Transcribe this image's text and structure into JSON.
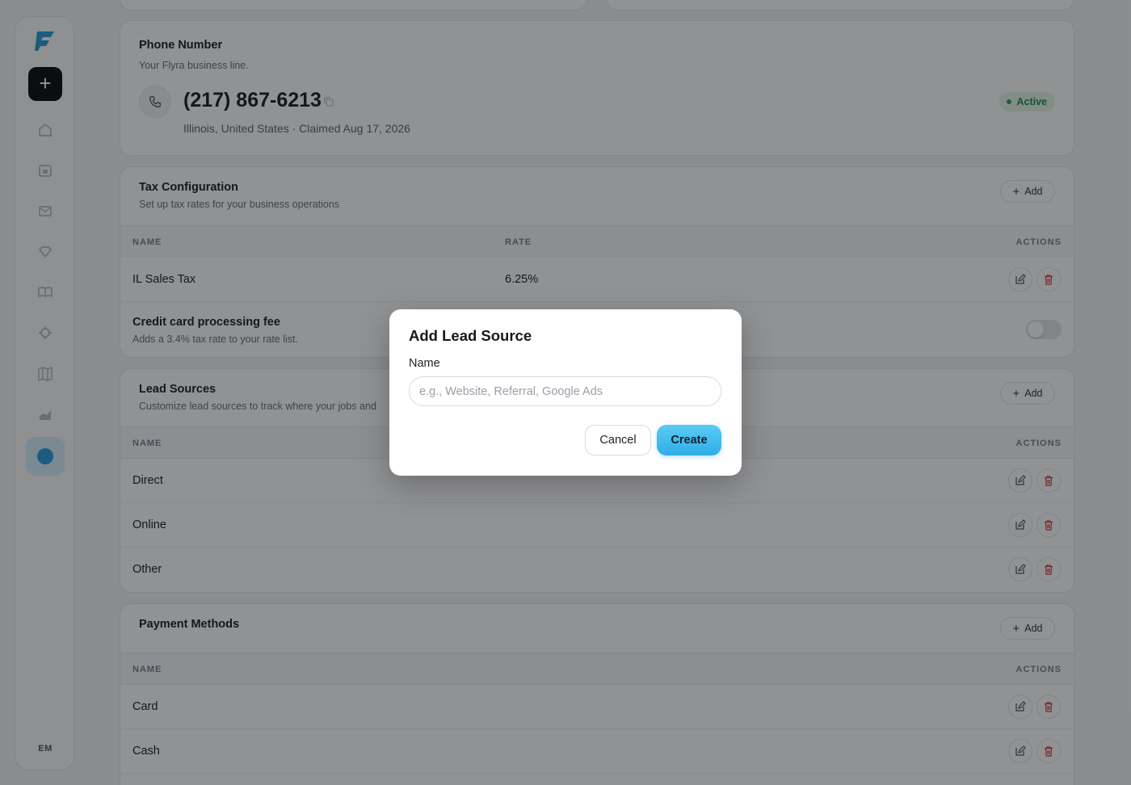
{
  "sidebar": {
    "new_label": "+",
    "avatar": "EM",
    "items": [
      "home-icon",
      "calendar-icon",
      "mail-icon",
      "diamond-icon",
      "book-icon",
      "settings-icon",
      "map-icon",
      "chart-icon"
    ]
  },
  "phone": {
    "title": "Phone Number",
    "subtitle": "Your Flyra business line.",
    "number": "(217) 867-6213",
    "meta": "Illinois, United States · Claimed Aug 17, 2026",
    "status": "Active"
  },
  "tax": {
    "title": "Tax Configuration",
    "subtitle": "Set up tax rates for your business operations",
    "add_label": "Add",
    "columns": [
      "NAME",
      "RATE",
      "ACTIONS"
    ],
    "rows": [
      {
        "name": "IL Sales Tax",
        "rate": "6.25%"
      }
    ],
    "fee_title": "Credit card processing fee",
    "fee_subtitle": "Adds a 3.4% tax rate to your rate list.",
    "fee_enabled": false
  },
  "lead_sources": {
    "title": "Lead Sources",
    "subtitle": "Customize lead sources to track where your jobs and",
    "add_label": "Add",
    "columns": [
      "NAME",
      "ACTIONS"
    ],
    "rows": [
      "Direct",
      "Online",
      "Other"
    ]
  },
  "payment_methods": {
    "title": "Payment Methods",
    "add_label": "Add",
    "columns": [
      "NAME",
      "ACTIONS"
    ],
    "rows": [
      "Card",
      "Cash"
    ]
  },
  "modal": {
    "title": "Add Lead Source",
    "name_label": "Name",
    "name_value": "",
    "name_placeholder": "e.g., Website, Referral, Google Ads",
    "cancel_label": "Cancel",
    "create_label": "Create"
  },
  "colors": {
    "accent": "#2eaee8",
    "danger": "#d43b3b",
    "success": "#1f8a4d"
  }
}
